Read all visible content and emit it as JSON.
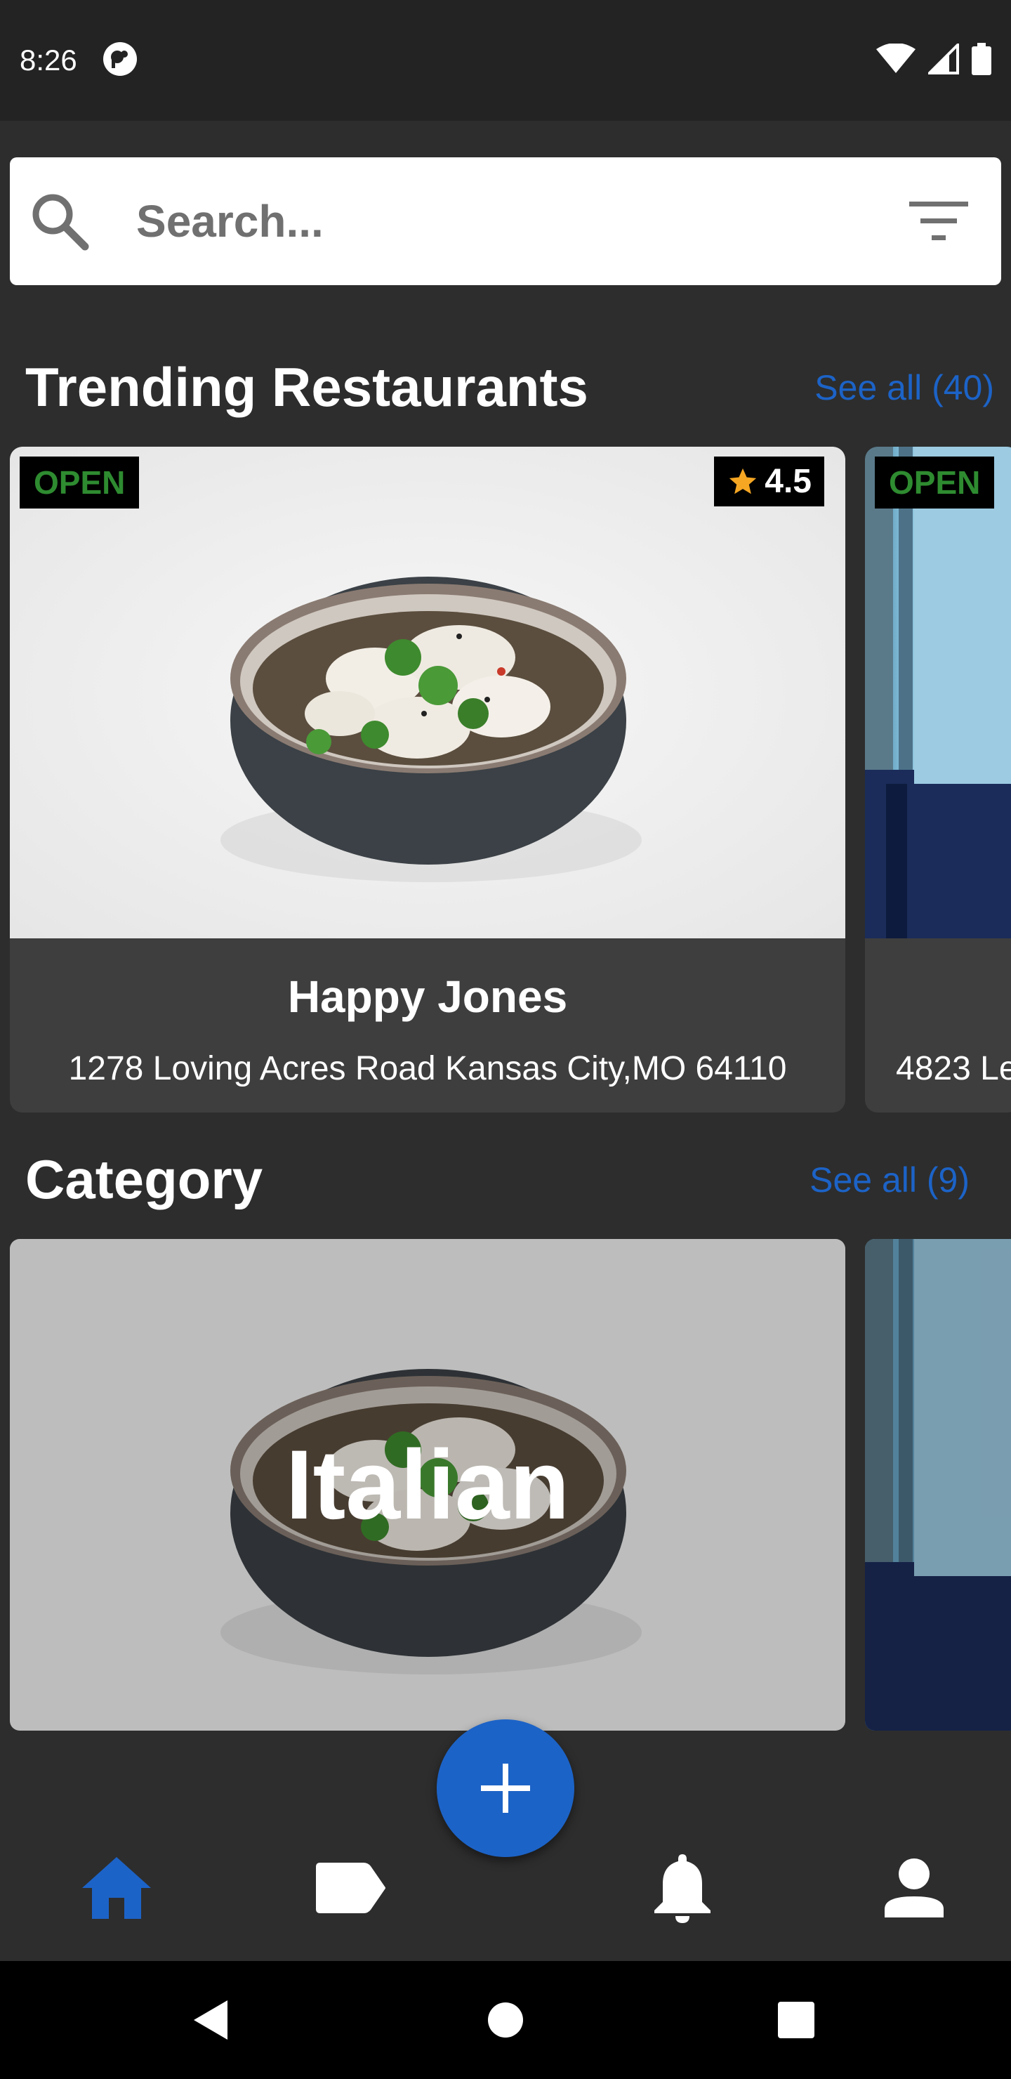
{
  "status_bar": {
    "time": "8:26"
  },
  "search": {
    "placeholder": "Search..."
  },
  "trending": {
    "title": "Trending Restaurants",
    "see_all": "See all (40)",
    "cards": [
      {
        "status": "OPEN",
        "rating": "4.5",
        "name": "Happy Jones",
        "address": "1278 Loving Acres Road Kansas City,MO 64110"
      },
      {
        "status": "OPEN",
        "address": "4823 Le"
      }
    ]
  },
  "category": {
    "title": "Category",
    "see_all": "See all (9)",
    "items": [
      {
        "label": "Italian"
      }
    ]
  },
  "bottom_nav": {
    "items": [
      {
        "icon": "home-icon",
        "active": true
      },
      {
        "icon": "tag-icon",
        "active": false
      },
      {
        "icon": "bell-icon",
        "active": false
      },
      {
        "icon": "person-icon",
        "active": false
      }
    ],
    "fab_icon": "plus-icon"
  },
  "colors": {
    "accent": "#1c63c7",
    "background": "#2d2d2d",
    "card": "#3e3e3e",
    "open_green": "#2e8b30",
    "star": "#f5a623"
  }
}
